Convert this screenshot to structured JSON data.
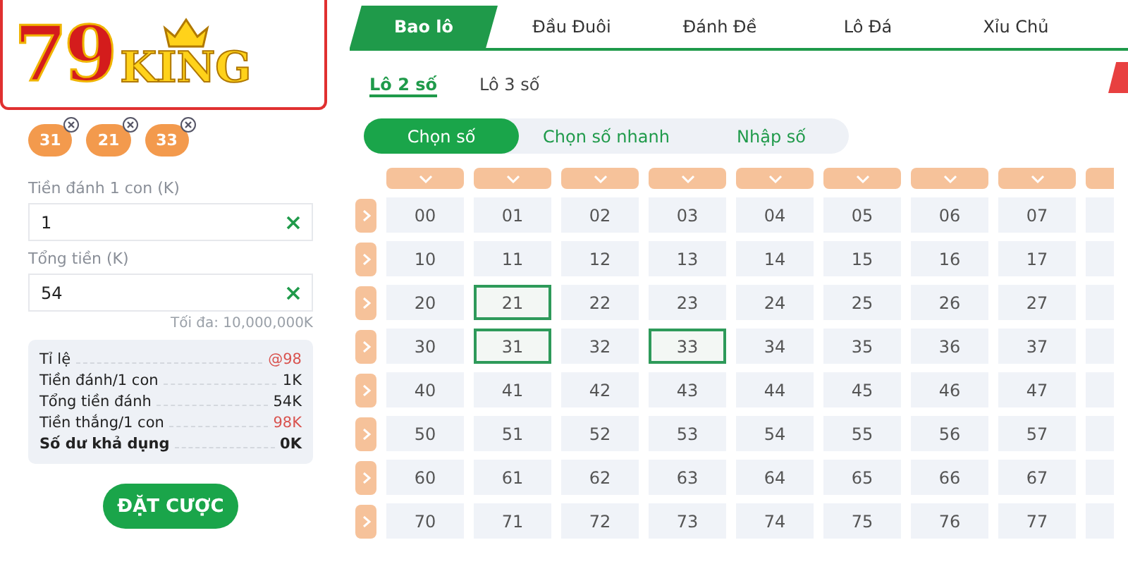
{
  "logo": {
    "number": "79",
    "word": "KING"
  },
  "picked": [
    {
      "label": "31"
    },
    {
      "label": "21"
    },
    {
      "label": "33"
    }
  ],
  "fields": [
    {
      "label": "Tiền đánh 1 con (K)",
      "value": "1"
    },
    {
      "label": "Tổng tiền (K)",
      "value": "54"
    }
  ],
  "max_hint": "Tối đa: 10,000,000K",
  "summary": [
    {
      "label": "Tỉ lệ",
      "value": "@98",
      "kind": "red"
    },
    {
      "label": "Tiền đánh/1 con",
      "value": "1K",
      "kind": "plain"
    },
    {
      "label": "Tổng tiền đánh",
      "value": "54K",
      "kind": "plain"
    },
    {
      "label": "Tiền thắng/1 con",
      "value": "98K",
      "kind": "red"
    },
    {
      "label": "Số dư khả dụng",
      "value": "0K",
      "kind": "bold"
    }
  ],
  "submit": "ĐẶT CƯỢC",
  "tabs": [
    {
      "label": "Bao lô",
      "selected": true
    },
    {
      "label": "Đầu Đuôi",
      "selected": false
    },
    {
      "label": "Đánh Đề",
      "selected": false
    },
    {
      "label": "Lô Đá",
      "selected": false
    },
    {
      "label": "Xỉu Chủ",
      "selected": false
    }
  ],
  "subtabs": [
    {
      "label": "Lô 2 số",
      "selected": true
    },
    {
      "label": "Lô 3 số",
      "selected": false
    }
  ],
  "modes": [
    {
      "label": "Chọn số",
      "selected": true
    },
    {
      "label": "Chọn số nhanh",
      "selected": false
    },
    {
      "label": "Nhập số",
      "selected": false
    }
  ],
  "grid": [
    {
      "cells": [
        {
          "label": "00",
          "selected": false
        },
        {
          "label": "01",
          "selected": false
        },
        {
          "label": "02",
          "selected": false
        },
        {
          "label": "03",
          "selected": false
        },
        {
          "label": "04",
          "selected": false
        },
        {
          "label": "05",
          "selected": false
        },
        {
          "label": "06",
          "selected": false
        },
        {
          "label": "07",
          "selected": false
        }
      ]
    },
    {
      "cells": [
        {
          "label": "10",
          "selected": false
        },
        {
          "label": "11",
          "selected": false
        },
        {
          "label": "12",
          "selected": false
        },
        {
          "label": "13",
          "selected": false
        },
        {
          "label": "14",
          "selected": false
        },
        {
          "label": "15",
          "selected": false
        },
        {
          "label": "16",
          "selected": false
        },
        {
          "label": "17",
          "selected": false
        }
      ]
    },
    {
      "cells": [
        {
          "label": "20",
          "selected": false
        },
        {
          "label": "21",
          "selected": true
        },
        {
          "label": "22",
          "selected": false
        },
        {
          "label": "23",
          "selected": false
        },
        {
          "label": "24",
          "selected": false
        },
        {
          "label": "25",
          "selected": false
        },
        {
          "label": "26",
          "selected": false
        },
        {
          "label": "27",
          "selected": false
        }
      ]
    },
    {
      "cells": [
        {
          "label": "30",
          "selected": false
        },
        {
          "label": "31",
          "selected": true
        },
        {
          "label": "32",
          "selected": false
        },
        {
          "label": "33",
          "selected": true
        },
        {
          "label": "34",
          "selected": false
        },
        {
          "label": "35",
          "selected": false
        },
        {
          "label": "36",
          "selected": false
        },
        {
          "label": "37",
          "selected": false
        }
      ]
    },
    {
      "cells": [
        {
          "label": "40",
          "selected": false
        },
        {
          "label": "41",
          "selected": false
        },
        {
          "label": "42",
          "selected": false
        },
        {
          "label": "43",
          "selected": false
        },
        {
          "label": "44",
          "selected": false
        },
        {
          "label": "45",
          "selected": false
        },
        {
          "label": "46",
          "selected": false
        },
        {
          "label": "47",
          "selected": false
        }
      ]
    },
    {
      "cells": [
        {
          "label": "50",
          "selected": false
        },
        {
          "label": "51",
          "selected": false
        },
        {
          "label": "52",
          "selected": false
        },
        {
          "label": "53",
          "selected": false
        },
        {
          "label": "54",
          "selected": false
        },
        {
          "label": "55",
          "selected": false
        },
        {
          "label": "56",
          "selected": false
        },
        {
          "label": "57",
          "selected": false
        }
      ]
    },
    {
      "cells": [
        {
          "label": "60",
          "selected": false
        },
        {
          "label": "61",
          "selected": false
        },
        {
          "label": "62",
          "selected": false
        },
        {
          "label": "63",
          "selected": false
        },
        {
          "label": "64",
          "selected": false
        },
        {
          "label": "65",
          "selected": false
        },
        {
          "label": "66",
          "selected": false
        },
        {
          "label": "67",
          "selected": false
        }
      ]
    },
    {
      "cells": [
        {
          "label": "70",
          "selected": false
        },
        {
          "label": "71",
          "selected": false
        },
        {
          "label": "72",
          "selected": false
        },
        {
          "label": "73",
          "selected": false
        },
        {
          "label": "74",
          "selected": false
        },
        {
          "label": "75",
          "selected": false
        },
        {
          "label": "76",
          "selected": false
        },
        {
          "label": "77",
          "selected": false
        }
      ]
    }
  ]
}
